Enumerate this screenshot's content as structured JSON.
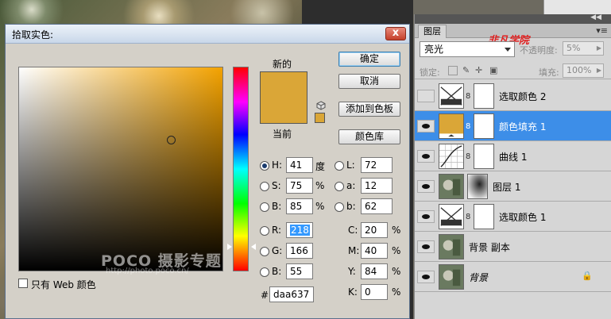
{
  "picker": {
    "title": "拾取实色:",
    "close_label": "x",
    "new_label": "新的",
    "current_label": "当前",
    "buttons": {
      "ok": "确定",
      "cancel": "取消",
      "add_swatch": "添加到色板",
      "libraries": "颜色库"
    },
    "web_only_label": "只有 Web 颜色",
    "hsb": {
      "h": "41",
      "s": "75",
      "b": "85",
      "h_unit": "度",
      "s_unit": "%",
      "b_unit": "%"
    },
    "lab": {
      "l": "72",
      "a": "12",
      "b": "62"
    },
    "rgb": {
      "r": "218",
      "g": "166",
      "b": "55"
    },
    "cmyk": {
      "c": "20",
      "m": "40",
      "y": "84",
      "k": "0",
      "unit": "%"
    },
    "hex": "daa637",
    "labels": {
      "h": "H:",
      "s": "S:",
      "b": "B:",
      "l": "L:",
      "a": "a:",
      "lb": "b:",
      "r": "R:",
      "g": "G:",
      "rb": "B:",
      "c": "C:",
      "m": "M:",
      "y": "Y:",
      "k": "K:",
      "hash": "#"
    },
    "colors": {
      "new": "#daa637",
      "current": "#daa637"
    },
    "watermark": "POCO 摄影专题",
    "watermark_url": "http://photo.poco.cn/"
  },
  "layers_panel": {
    "tab": "图层",
    "logo": "非凡学院",
    "blend_mode": "亮光",
    "opacity_label": "不透明度:",
    "opacity": "5%",
    "lock_label": "锁定:",
    "fill_label": "填充:",
    "fill": "100%",
    "layers": [
      {
        "name": "选取颜色 2",
        "visible": false,
        "selected": false,
        "thumb": "selective-color-icon"
      },
      {
        "name": "颜色填充 1",
        "visible": true,
        "selected": true,
        "thumb": "color-fill-icon"
      },
      {
        "name": "曲线 1",
        "visible": true,
        "selected": false,
        "thumb": "curves-icon"
      },
      {
        "name": "图层 1",
        "visible": true,
        "selected": false,
        "thumb": "photo-thumb"
      },
      {
        "name": "选取颜色 1",
        "visible": true,
        "selected": false,
        "thumb": "selective-color-icon"
      },
      {
        "name": "背景 副本",
        "visible": true,
        "selected": false,
        "thumb": "photo-thumb"
      },
      {
        "name": "背景",
        "visible": true,
        "selected": false,
        "thumb": "photo-thumb"
      }
    ]
  }
}
